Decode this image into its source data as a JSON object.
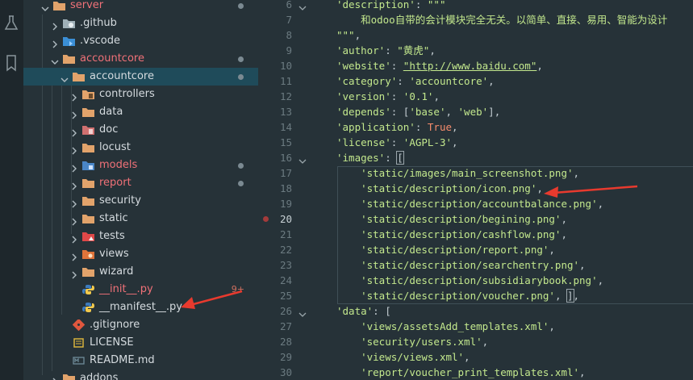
{
  "colors": {
    "accent": "#f07178",
    "selection": "#1f4b5a",
    "arrow": "#e83a2e"
  },
  "activity": [
    {
      "icon": "beaker-icon"
    },
    {
      "icon": "bookmark-icon"
    }
  ],
  "tree": [
    {
      "label": "server",
      "icon": "folder-open-icon",
      "chevron": "down",
      "indent": 0,
      "color": "red",
      "dot": true
    },
    {
      "label": ".github",
      "icon": "github-folder-icon",
      "chevron": "right",
      "indent": 1
    },
    {
      "label": ".vscode",
      "icon": "vscode-folder-icon",
      "chevron": "right",
      "indent": 1
    },
    {
      "label": "accountcore",
      "icon": "folder-open-icon",
      "chevron": "down",
      "indent": 1,
      "color": "red",
      "dot": true
    },
    {
      "label": "accountcore",
      "icon": "folder-open-icon",
      "chevron": "down",
      "indent": 2,
      "selected": true,
      "dot": true
    },
    {
      "label": "controllers",
      "icon": "folder-controllers-icon",
      "chevron": "right",
      "indent": 3
    },
    {
      "label": "data",
      "icon": "folder-data-icon",
      "chevron": "right",
      "indent": 3
    },
    {
      "label": "doc",
      "icon": "folder-doc-icon",
      "chevron": "right",
      "indent": 3
    },
    {
      "label": "locust",
      "icon": "folder-icon",
      "chevron": "right",
      "indent": 3
    },
    {
      "label": "models",
      "icon": "folder-models-icon",
      "chevron": "right",
      "indent": 3,
      "color": "red",
      "dot": true
    },
    {
      "label": "report",
      "icon": "folder-icon",
      "chevron": "right",
      "indent": 3,
      "color": "red",
      "dot": true
    },
    {
      "label": "security",
      "icon": "folder-icon",
      "chevron": "right",
      "indent": 3
    },
    {
      "label": "static",
      "icon": "folder-icon",
      "chevron": "right",
      "indent": 3
    },
    {
      "label": "tests",
      "icon": "folder-tests-icon",
      "chevron": "right",
      "indent": 3
    },
    {
      "label": "views",
      "icon": "folder-views-icon",
      "chevron": "right",
      "indent": 3
    },
    {
      "label": "wizard",
      "icon": "folder-icon",
      "chevron": "right",
      "indent": 3
    },
    {
      "label": "__init__.py",
      "icon": "python-file-icon",
      "indent": 3,
      "color": "red",
      "badge": "9+"
    },
    {
      "label": "__manifest__.py",
      "icon": "python-file-icon",
      "indent": 3
    },
    {
      "label": ".gitignore",
      "icon": "git-file-icon",
      "indent": 2
    },
    {
      "label": "LICENSE",
      "icon": "license-file-icon",
      "indent": 2
    },
    {
      "label": "README.md",
      "icon": "markdown-file-icon",
      "indent": 2
    },
    {
      "label": "addons",
      "icon": "folder-icon",
      "chevron": "right",
      "indent": 1
    }
  ],
  "code": [
    {
      "n": "6",
      "fold": true,
      "parts": [
        [
          "k",
          "'description'"
        ],
        [
          "c",
          ": "
        ],
        [
          "k",
          "\"\"\""
        ]
      ]
    },
    {
      "n": "7",
      "parts": [
        [
          "k",
          "    和odoo自带的会计模块完全无关。以简单、直接、易用、智能为设计"
        ]
      ]
    },
    {
      "n": "8",
      "parts": [
        [
          "k",
          "\"\"\""
        ],
        [
          "c",
          ","
        ]
      ]
    },
    {
      "n": "9",
      "parts": [
        [
          "k",
          "'author'"
        ],
        [
          "c",
          ": "
        ],
        [
          "k",
          "\"黄虎\""
        ],
        [
          "c",
          ","
        ]
      ]
    },
    {
      "n": "10",
      "parts": [
        [
          "k",
          "'website'"
        ],
        [
          "c",
          ": "
        ],
        [
          "lnk",
          "\"http://www.baidu.com\""
        ],
        [
          "c",
          ","
        ]
      ]
    },
    {
      "n": "11",
      "parts": [
        [
          "k",
          "'category'"
        ],
        [
          "c",
          ": "
        ],
        [
          "k",
          "'accountcore'"
        ],
        [
          "c",
          ","
        ]
      ]
    },
    {
      "n": "12",
      "parts": [
        [
          "k",
          "'version'"
        ],
        [
          "c",
          ": "
        ],
        [
          "k",
          "'0.1'"
        ],
        [
          "c",
          ","
        ]
      ]
    },
    {
      "n": "13",
      "parts": [
        [
          "k",
          "'depends'"
        ],
        [
          "c",
          ": ["
        ],
        [
          "k",
          "'base'"
        ],
        [
          "c",
          ", "
        ],
        [
          "k",
          "'web'"
        ],
        [
          "c",
          "],"
        ]
      ]
    },
    {
      "n": "14",
      "parts": [
        [
          "k",
          "'application'"
        ],
        [
          "c",
          ": "
        ],
        [
          "lit",
          "True"
        ],
        [
          "c",
          ","
        ]
      ]
    },
    {
      "n": "15",
      "parts": [
        [
          "k",
          "'license'"
        ],
        [
          "c",
          ": "
        ],
        [
          "k",
          "'AGPL-3'"
        ],
        [
          "c",
          ","
        ]
      ]
    },
    {
      "n": "16",
      "fold": true,
      "parts": [
        [
          "k",
          "'images'"
        ],
        [
          "c",
          ": "
        ],
        [
          "box",
          "["
        ]
      ]
    },
    {
      "n": "17",
      "parts": [
        [
          "c",
          "    "
        ],
        [
          "k",
          "'static/images/main_screenshot.png'"
        ],
        [
          "c",
          ","
        ]
      ]
    },
    {
      "n": "18",
      "parts": [
        [
          "c",
          "    "
        ],
        [
          "k",
          "'static/description/icon.png'"
        ],
        [
          "c",
          ","
        ]
      ]
    },
    {
      "n": "19",
      "parts": [
        [
          "c",
          "    "
        ],
        [
          "k",
          "'static/description/accountbalance.png'"
        ],
        [
          "c",
          ","
        ]
      ]
    },
    {
      "n": "20",
      "breakpoint": true,
      "active": true,
      "parts": [
        [
          "c",
          "    "
        ],
        [
          "k",
          "'static/description/begining.png'"
        ],
        [
          "c",
          ","
        ]
      ]
    },
    {
      "n": "21",
      "parts": [
        [
          "c",
          "    "
        ],
        [
          "k",
          "'static/description/cashflow.png'"
        ],
        [
          "c",
          ","
        ]
      ]
    },
    {
      "n": "22",
      "parts": [
        [
          "c",
          "    "
        ],
        [
          "k",
          "'static/description/report.png'"
        ],
        [
          "c",
          ","
        ]
      ]
    },
    {
      "n": "23",
      "parts": [
        [
          "c",
          "    "
        ],
        [
          "k",
          "'static/description/searchentry.png'"
        ],
        [
          "c",
          ","
        ]
      ]
    },
    {
      "n": "24",
      "parts": [
        [
          "c",
          "    "
        ],
        [
          "k",
          "'static/description/subsidiarybook.png'"
        ],
        [
          "c",
          ","
        ]
      ]
    },
    {
      "n": "25",
      "parts": [
        [
          "c",
          "    "
        ],
        [
          "k",
          "'static/description/voucher.png'"
        ],
        [
          "c",
          ", "
        ],
        [
          "box",
          "]"
        ],
        [
          "c",
          ","
        ]
      ]
    },
    {
      "n": "26",
      "fold": true,
      "parts": [
        [
          "k",
          "'data'"
        ],
        [
          "c",
          ": ["
        ]
      ]
    },
    {
      "n": "27",
      "parts": [
        [
          "c",
          "    "
        ],
        [
          "k",
          "'views/assetsAdd_templates.xml'"
        ],
        [
          "c",
          ","
        ]
      ]
    },
    {
      "n": "28",
      "parts": [
        [
          "c",
          "    "
        ],
        [
          "k",
          "'security/users.xml'"
        ],
        [
          "c",
          ","
        ]
      ]
    },
    {
      "n": "29",
      "parts": [
        [
          "c",
          "    "
        ],
        [
          "k",
          "'views/views.xml'"
        ],
        [
          "c",
          ","
        ]
      ]
    },
    {
      "n": "30",
      "parts": [
        [
          "c",
          "    "
        ],
        [
          "k",
          "'report/voucher_print_templates.xml'"
        ],
        [
          "c",
          ","
        ]
      ]
    }
  ]
}
